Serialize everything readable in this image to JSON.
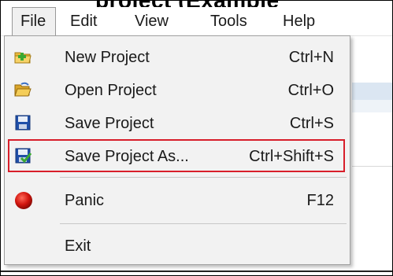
{
  "top_cut_text": "project (Example",
  "menubar": {
    "items": [
      {
        "label": "File",
        "active": true
      },
      {
        "label": "Edit",
        "active": false
      },
      {
        "label": "View",
        "active": false
      },
      {
        "label": "Tools",
        "active": false
      },
      {
        "label": "Help",
        "active": false
      }
    ]
  },
  "file_menu": {
    "items": [
      {
        "label": "New Project",
        "shortcut": "Ctrl+N",
        "icon": "new-project-folder-plus-icon"
      },
      {
        "label": "Open Project",
        "shortcut": "Ctrl+O",
        "icon": "open-folder-icon"
      },
      {
        "label": "Save Project",
        "shortcut": "Ctrl+S",
        "icon": "floppy-disk-icon"
      },
      {
        "label": "Save Project As...",
        "shortcut": "Ctrl+Shift+S",
        "icon": "floppy-disk-checkmark-icon",
        "highlighted": true
      },
      {
        "label": "Panic",
        "shortcut": "F12",
        "icon": "red-circle-icon"
      },
      {
        "label": "Exit",
        "shortcut": "",
        "icon": ""
      }
    ]
  },
  "colors": {
    "highlight_border": "#d81e2a",
    "menu_background": "#f2f2f2",
    "panic_red": "#cc1a1a"
  }
}
